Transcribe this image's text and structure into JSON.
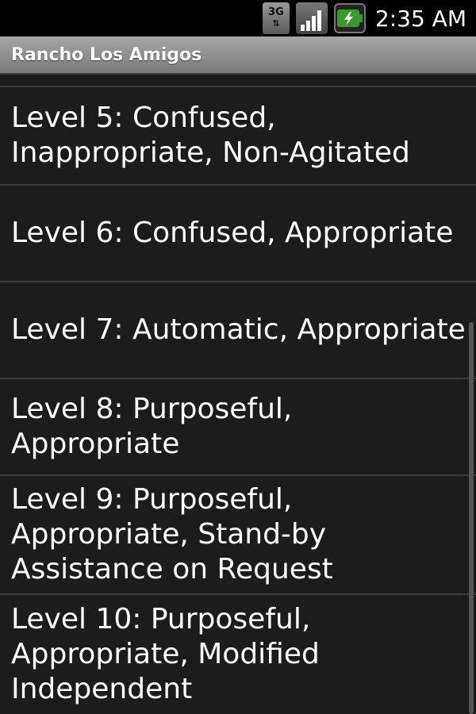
{
  "status_bar": {
    "network_label": "3G",
    "time": "2:35 AM"
  },
  "app": {
    "title": "Rancho Los Amigos"
  },
  "list": {
    "items": [
      {
        "label": "Level 5: Confused, Inappropriate, Non-Agitated"
      },
      {
        "label": "Level 6: Confused, Appropriate"
      },
      {
        "label": "Level 7: Automatic, Appropriate"
      },
      {
        "label": "Level 8: Purposeful, Appropriate"
      },
      {
        "label": "Level 9: Purposeful, Appropriate, Stand-by Assistance on Request"
      },
      {
        "label": "Level 10: Purposeful, Appropriate, Modified Independent"
      }
    ]
  },
  "colors": {
    "background": "#1c1c1c",
    "title_bar": "#8e8e8e",
    "divider": "#3a3a3a",
    "text": "#ffffff"
  }
}
